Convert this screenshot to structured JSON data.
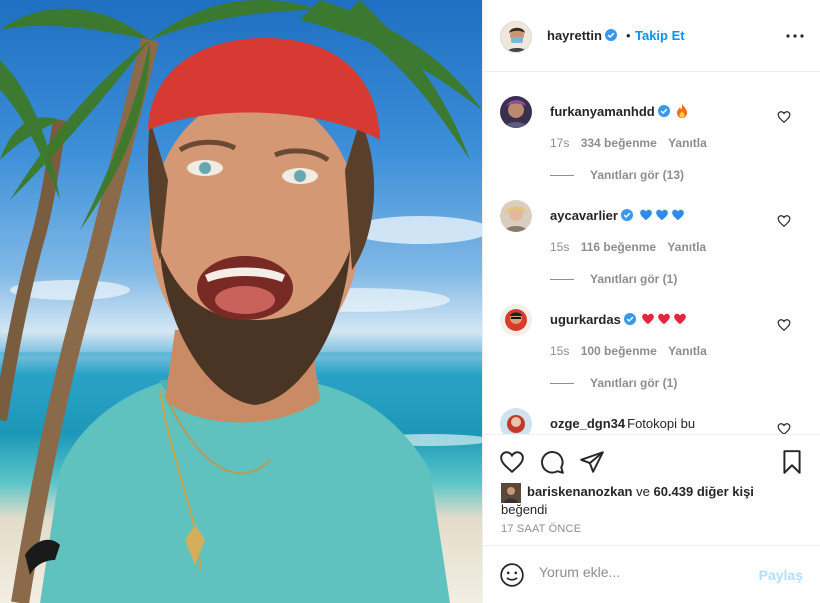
{
  "post": {
    "author": "hayrettin",
    "separator": "•",
    "follow_label": "Takip Et",
    "more_icon": "more-horizontal-icon"
  },
  "comments": [
    {
      "user": "furkanyamanhdd",
      "text": "",
      "emoji": [
        "fire"
      ],
      "time": "17s",
      "likes": "334 beğenme",
      "reply": "Yanıtla",
      "view_replies": "Yanıtları gör (13)"
    },
    {
      "user": "aycavarlier",
      "text": "",
      "emoji": [
        "blue-heart",
        "blue-heart",
        "blue-heart"
      ],
      "time": "15s",
      "likes": "116 beğenme",
      "reply": "Yanıtla",
      "view_replies": "Yanıtları gör (1)"
    },
    {
      "user": "ugurkardas",
      "text": "",
      "emoji": [
        "red-heart",
        "red-heart",
        "red-heart"
      ],
      "time": "15s",
      "likes": "100 beğenme",
      "reply": "Yanıtla",
      "view_replies": "Yanıtları gör (1)"
    },
    {
      "user": "ozge_dgn34",
      "text": "Fotokopi bu",
      "emoji": [],
      "time": "",
      "likes": "",
      "reply": "",
      "view_replies": ""
    }
  ],
  "likes": {
    "first_user": "bariskenanozkan",
    "connector": " ve ",
    "others": "60.439 diğer kişi",
    "suffix": "beğendi"
  },
  "timestamp": "17 SAAT ÖNCE",
  "add_comment": {
    "placeholder": "Yorum ekle...",
    "post_label": "Paylaş"
  },
  "colors": {
    "accent": "#0095f6",
    "post_disabled": "#b2dffc",
    "muted": "#8e8e8e",
    "text": "#262626"
  }
}
